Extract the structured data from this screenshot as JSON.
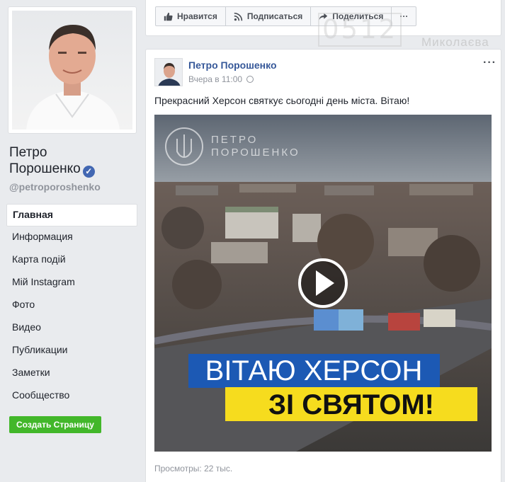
{
  "sidebar": {
    "page_name_line1": "Петро",
    "page_name_line2": "Порошенко",
    "handle": "@petroporoshenko",
    "nav": [
      {
        "label": "Главная",
        "active": true
      },
      {
        "label": "Информация"
      },
      {
        "label": "Карта подій"
      },
      {
        "label": "Мій Instagram"
      },
      {
        "label": "Фото"
      },
      {
        "label": "Видео"
      },
      {
        "label": "Публикации"
      },
      {
        "label": "Заметки"
      },
      {
        "label": "Сообщество"
      }
    ],
    "create_page_label": "Создать Страницу"
  },
  "actions": {
    "like": "Нравится",
    "subscribe": "Подписаться",
    "share": "Поделиться",
    "more": "···"
  },
  "watermark": {
    "number": "0512",
    "city": "Миколаєва"
  },
  "post": {
    "author": "Петро Порошенко",
    "time": "Вчера в 11:00",
    "menu": "···",
    "text": "Прекрасний Херсон святкує сьогодні день міста. Вітаю!",
    "video": {
      "logo_line1": "ПЕТРО",
      "logo_line2": "ПОРОШЕНКО",
      "banner_line1": "ВІТАЮ ХЕРСОН",
      "banner_line2": "ЗІ СВЯТОМ!"
    },
    "views": "Просмотры: 22 тыс."
  },
  "colors": {
    "link": "#365899",
    "brand_blue": "#4267b2",
    "green_button": "#42b72a",
    "banner_blue": "#1c59b4",
    "banner_yellow": "#f6dc1e"
  }
}
